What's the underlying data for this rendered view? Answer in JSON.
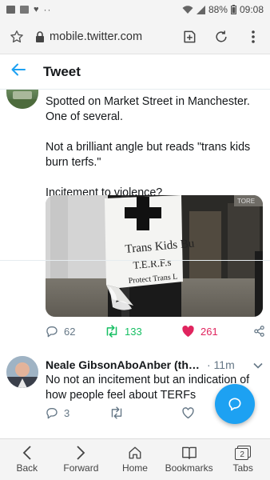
{
  "status_bar": {
    "battery": "88%",
    "time": "09:08",
    "overflow": "··"
  },
  "browser": {
    "url": "mobile.twitter.com"
  },
  "header": {
    "title": "Tweet"
  },
  "tweet": {
    "paragraphs": [
      "Spotted on Market Street in Manchester. One of several.",
      "Not a brilliant angle but reads \"trans kids burn terfs.\"",
      "Incitement to violence?"
    ],
    "image_text": [
      "Trans Kids Bu",
      "T.E.R.F.s",
      "Protect Trans L"
    ],
    "image_sign": "TORE",
    "counts": {
      "replies": "62",
      "retweets": "133",
      "likes": "261"
    }
  },
  "reply": {
    "name": "Neale GibsonAboAnber (the real ...",
    "time": "· 11m",
    "text": "No not an incitement but an indication of how people feel about TERFs",
    "counts": {
      "replies": "3"
    }
  },
  "bottom_nav": {
    "back": "Back",
    "forward": "Forward",
    "home": "Home",
    "bookmarks": "Bookmarks",
    "tabs": "Tabs",
    "tab_count": "2"
  },
  "colors": {
    "accent": "#1da1f2",
    "retweet": "#17bf63",
    "like": "#e0245e",
    "muted": "#657786"
  },
  "icons": [
    "star-icon",
    "lock-icon",
    "new-tab-icon",
    "reload-icon",
    "menu-icon",
    "back-arrow-icon",
    "reply-icon",
    "retweet-icon",
    "heart-icon",
    "share-icon",
    "chevron-down-icon",
    "compose-icon"
  ]
}
